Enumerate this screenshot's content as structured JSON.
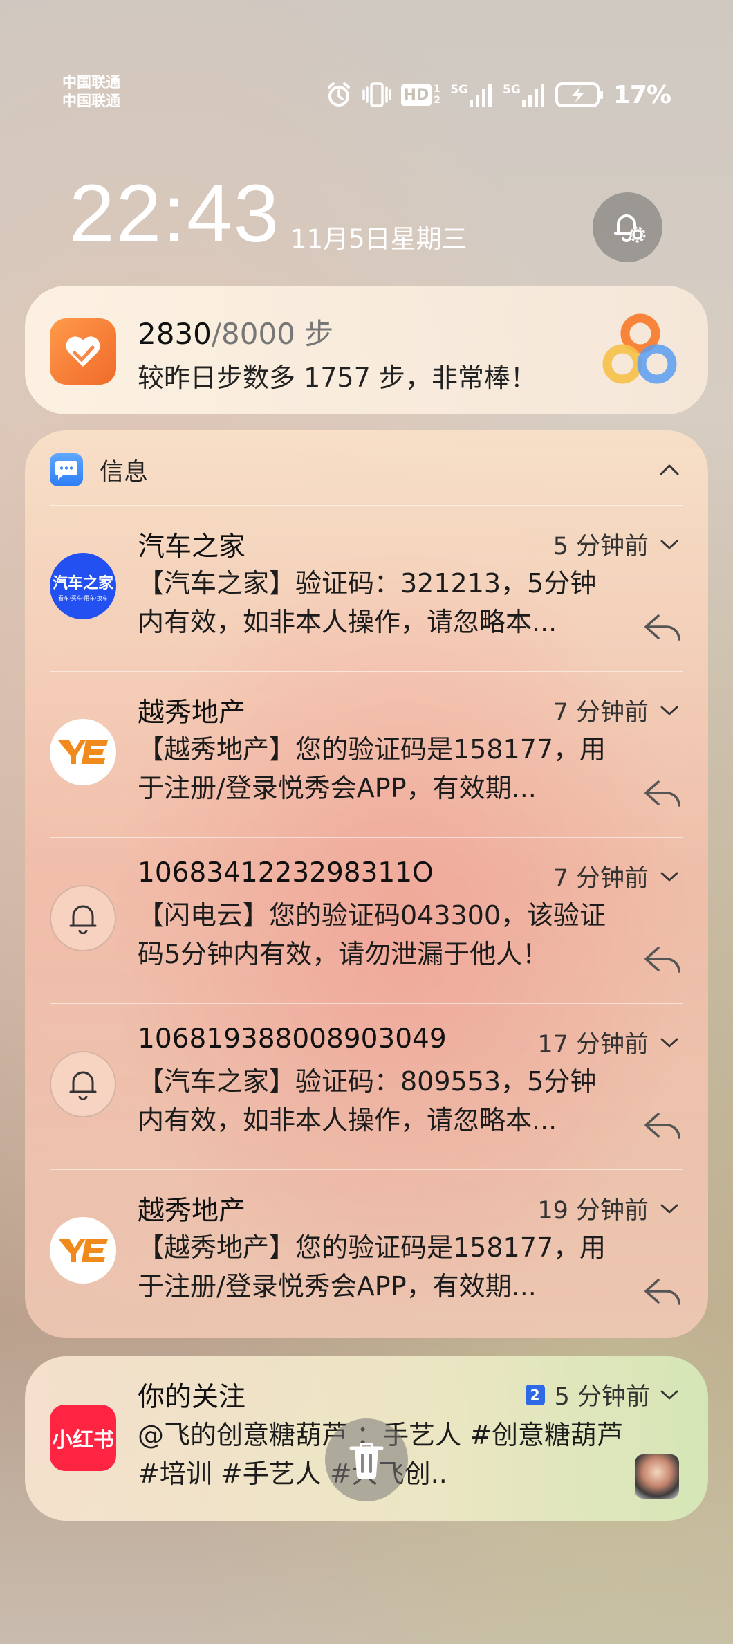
{
  "status_bar": {
    "carrier_1": "中国联通",
    "carrier_2": "中国联通",
    "hd_label": "HD",
    "hd_sub": "1 2",
    "sim1_net": "5G",
    "sim2_net": "5G",
    "battery": "17%",
    "icons": [
      "alarm-icon",
      "vibrate-icon",
      "hd-icon",
      "signal-icon",
      "signal-icon",
      "battery-charging-icon"
    ]
  },
  "lock": {
    "time": "22:43",
    "date": "11月5日星期三"
  },
  "health": {
    "steps": "2830",
    "goal": "/8000 步",
    "message": "较昨日步数多 1757 步，非常棒！"
  },
  "messages": {
    "app_name": "信息",
    "items": [
      {
        "sender": "汽车之家",
        "time": "5 分钟前",
        "body": "【汽车之家】验证码：321213，5分钟内有效，如非本人操作，请忽略本...",
        "avatar": "autohome",
        "avatar_text": "汽车之家",
        "avatar_sub": "看车·买车·用车·换车"
      },
      {
        "sender": "越秀地产",
        "time": "7 分钟前",
        "body": "【越秀地产】您的验证码是158177，用于注册/登录悦秀会APP，有效期...",
        "avatar": "yuexiu"
      },
      {
        "sender": "1068341223298311O",
        "time": "7 分钟前",
        "body": "【闪电云】您的验证码043300，该验证码5分钟内有效，请勿泄漏于他人！",
        "avatar": "bell"
      },
      {
        "sender": "10681938800890304​9",
        "time": "17 分钟前",
        "body": "【汽车之家】验证码：809553，5分钟内有效，如非本人操作，请忽略本...",
        "avatar": "bell"
      },
      {
        "sender": "越秀地产",
        "time": "19 分钟前",
        "body": "【越秀地产】您的验证码是158177，用于注册/登录悦秀会APP，有效期...",
        "avatar": "yuexiu"
      }
    ]
  },
  "follow": {
    "app_icon_text": "小红书",
    "title": "你的关注",
    "badge": "2",
    "time": "5 分钟前",
    "body": "@飞的创意糖葫芦 ：手艺人 #创意糖葫芦 #培训 #手艺人 #大飞创.."
  },
  "colors": {
    "xhs_red": "#ff2442",
    "autohome_blue": "#2350f0",
    "health_orange": "#f06a2a"
  }
}
